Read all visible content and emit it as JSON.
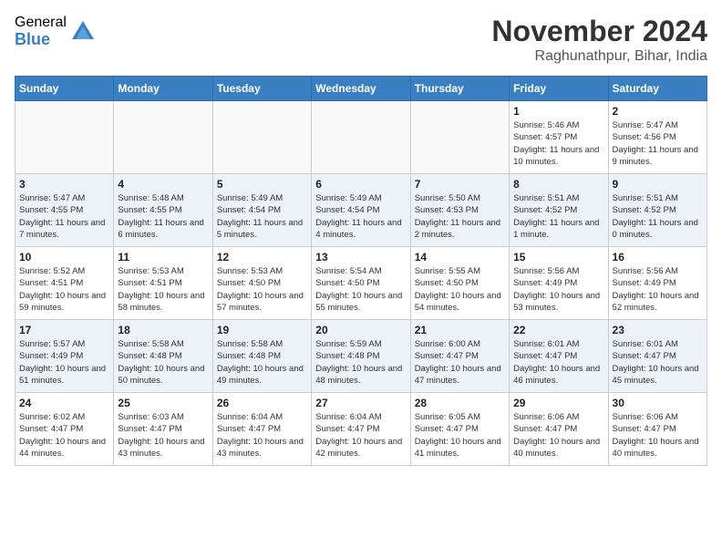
{
  "header": {
    "logo_general": "General",
    "logo_blue": "Blue",
    "month_title": "November 2024",
    "location": "Raghunathpur, Bihar, India"
  },
  "weekdays": [
    "Sunday",
    "Monday",
    "Tuesday",
    "Wednesday",
    "Thursday",
    "Friday",
    "Saturday"
  ],
  "weeks": [
    [
      {
        "day": "",
        "info": ""
      },
      {
        "day": "",
        "info": ""
      },
      {
        "day": "",
        "info": ""
      },
      {
        "day": "",
        "info": ""
      },
      {
        "day": "",
        "info": ""
      },
      {
        "day": "1",
        "info": "Sunrise: 5:46 AM\nSunset: 4:57 PM\nDaylight: 11 hours and 10 minutes."
      },
      {
        "day": "2",
        "info": "Sunrise: 5:47 AM\nSunset: 4:56 PM\nDaylight: 11 hours and 9 minutes."
      }
    ],
    [
      {
        "day": "3",
        "info": "Sunrise: 5:47 AM\nSunset: 4:55 PM\nDaylight: 11 hours and 7 minutes."
      },
      {
        "day": "4",
        "info": "Sunrise: 5:48 AM\nSunset: 4:55 PM\nDaylight: 11 hours and 6 minutes."
      },
      {
        "day": "5",
        "info": "Sunrise: 5:49 AM\nSunset: 4:54 PM\nDaylight: 11 hours and 5 minutes."
      },
      {
        "day": "6",
        "info": "Sunrise: 5:49 AM\nSunset: 4:54 PM\nDaylight: 11 hours and 4 minutes."
      },
      {
        "day": "7",
        "info": "Sunrise: 5:50 AM\nSunset: 4:53 PM\nDaylight: 11 hours and 2 minutes."
      },
      {
        "day": "8",
        "info": "Sunrise: 5:51 AM\nSunset: 4:52 PM\nDaylight: 11 hours and 1 minute."
      },
      {
        "day": "9",
        "info": "Sunrise: 5:51 AM\nSunset: 4:52 PM\nDaylight: 11 hours and 0 minutes."
      }
    ],
    [
      {
        "day": "10",
        "info": "Sunrise: 5:52 AM\nSunset: 4:51 PM\nDaylight: 10 hours and 59 minutes."
      },
      {
        "day": "11",
        "info": "Sunrise: 5:53 AM\nSunset: 4:51 PM\nDaylight: 10 hours and 58 minutes."
      },
      {
        "day": "12",
        "info": "Sunrise: 5:53 AM\nSunset: 4:50 PM\nDaylight: 10 hours and 57 minutes."
      },
      {
        "day": "13",
        "info": "Sunrise: 5:54 AM\nSunset: 4:50 PM\nDaylight: 10 hours and 55 minutes."
      },
      {
        "day": "14",
        "info": "Sunrise: 5:55 AM\nSunset: 4:50 PM\nDaylight: 10 hours and 54 minutes."
      },
      {
        "day": "15",
        "info": "Sunrise: 5:56 AM\nSunset: 4:49 PM\nDaylight: 10 hours and 53 minutes."
      },
      {
        "day": "16",
        "info": "Sunrise: 5:56 AM\nSunset: 4:49 PM\nDaylight: 10 hours and 52 minutes."
      }
    ],
    [
      {
        "day": "17",
        "info": "Sunrise: 5:57 AM\nSunset: 4:49 PM\nDaylight: 10 hours and 51 minutes."
      },
      {
        "day": "18",
        "info": "Sunrise: 5:58 AM\nSunset: 4:48 PM\nDaylight: 10 hours and 50 minutes."
      },
      {
        "day": "19",
        "info": "Sunrise: 5:58 AM\nSunset: 4:48 PM\nDaylight: 10 hours and 49 minutes."
      },
      {
        "day": "20",
        "info": "Sunrise: 5:59 AM\nSunset: 4:48 PM\nDaylight: 10 hours and 48 minutes."
      },
      {
        "day": "21",
        "info": "Sunrise: 6:00 AM\nSunset: 4:47 PM\nDaylight: 10 hours and 47 minutes."
      },
      {
        "day": "22",
        "info": "Sunrise: 6:01 AM\nSunset: 4:47 PM\nDaylight: 10 hours and 46 minutes."
      },
      {
        "day": "23",
        "info": "Sunrise: 6:01 AM\nSunset: 4:47 PM\nDaylight: 10 hours and 45 minutes."
      }
    ],
    [
      {
        "day": "24",
        "info": "Sunrise: 6:02 AM\nSunset: 4:47 PM\nDaylight: 10 hours and 44 minutes."
      },
      {
        "day": "25",
        "info": "Sunrise: 6:03 AM\nSunset: 4:47 PM\nDaylight: 10 hours and 43 minutes."
      },
      {
        "day": "26",
        "info": "Sunrise: 6:04 AM\nSunset: 4:47 PM\nDaylight: 10 hours and 43 minutes."
      },
      {
        "day": "27",
        "info": "Sunrise: 6:04 AM\nSunset: 4:47 PM\nDaylight: 10 hours and 42 minutes."
      },
      {
        "day": "28",
        "info": "Sunrise: 6:05 AM\nSunset: 4:47 PM\nDaylight: 10 hours and 41 minutes."
      },
      {
        "day": "29",
        "info": "Sunrise: 6:06 AM\nSunset: 4:47 PM\nDaylight: 10 hours and 40 minutes."
      },
      {
        "day": "30",
        "info": "Sunrise: 6:06 AM\nSunset: 4:47 PM\nDaylight: 10 hours and 40 minutes."
      }
    ]
  ]
}
